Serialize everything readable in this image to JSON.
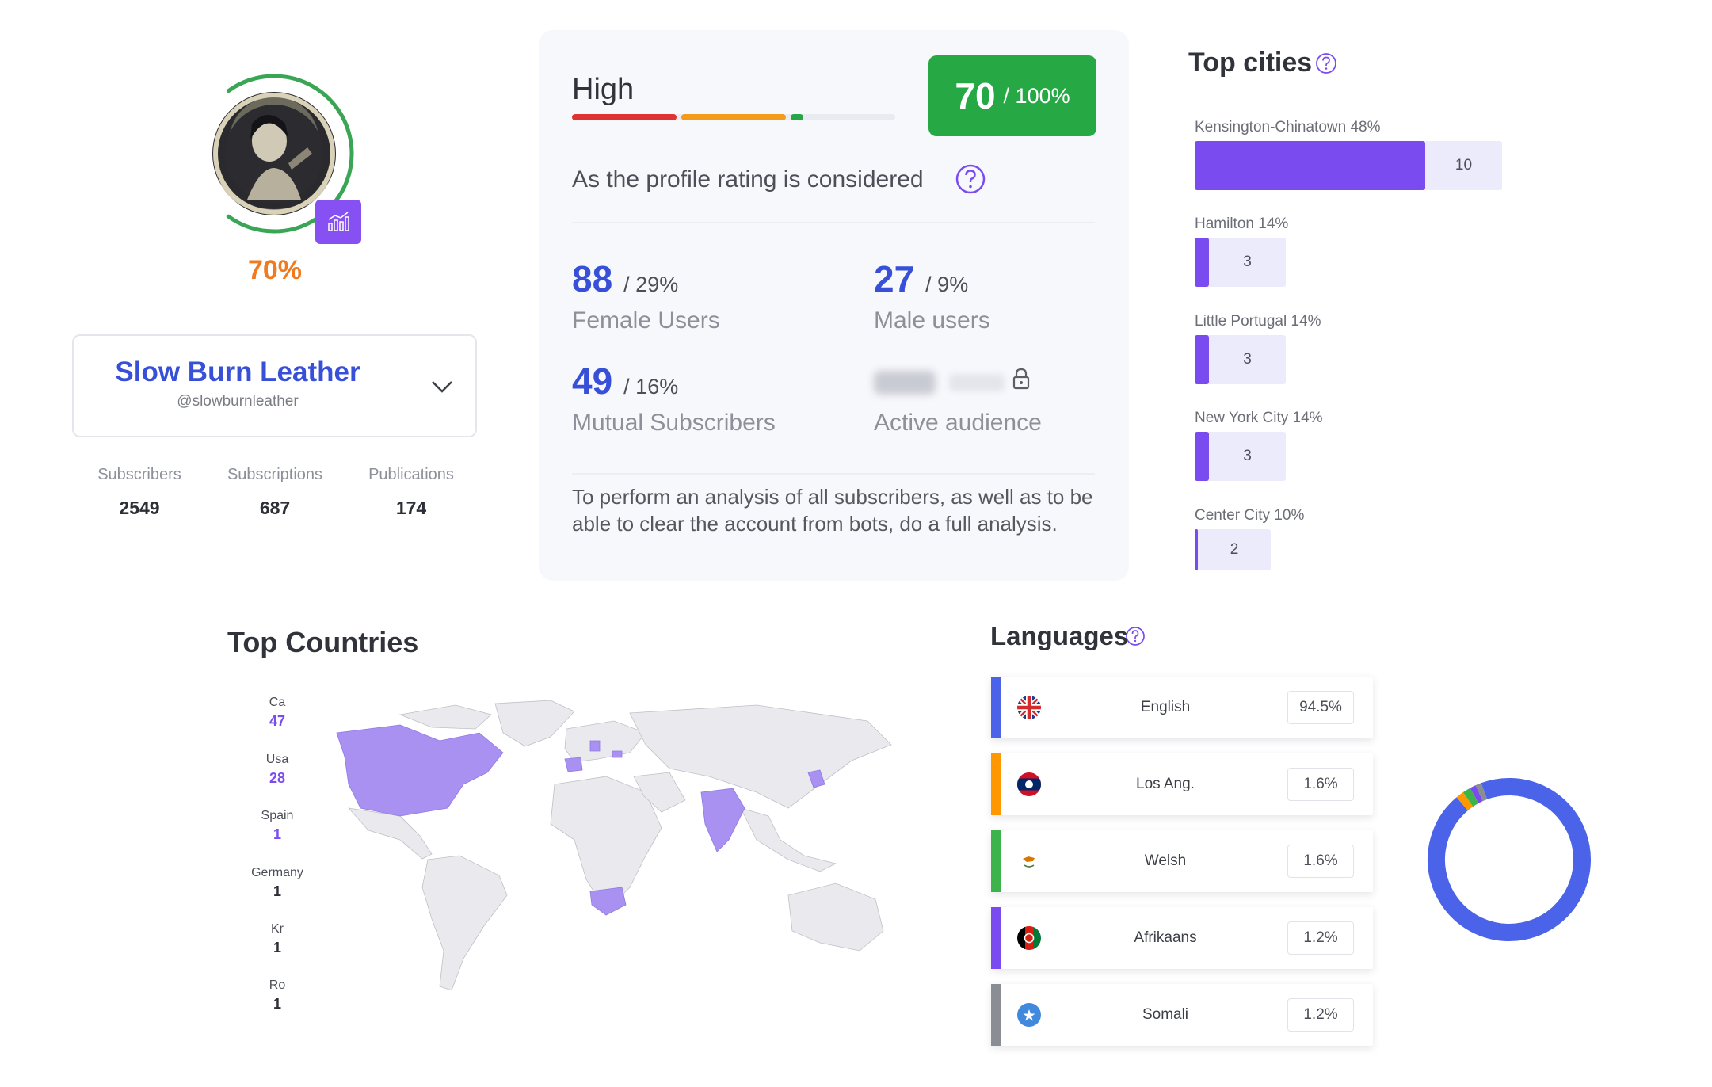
{
  "profile": {
    "rating_percent": "70%",
    "rating_value": 0.7,
    "name": "Slow Burn Leather",
    "handle": "@slowburnleather",
    "stats": [
      {
        "label": "Subscribers",
        "value": "2549"
      },
      {
        "label": "Subscriptions",
        "value": "687"
      },
      {
        "label": "Publications",
        "value": "174"
      }
    ]
  },
  "rating": {
    "level": "High",
    "score": "70",
    "score_total": "/ 100%",
    "score_value": 0.7,
    "description": "As the profile rating is considered",
    "metrics": [
      {
        "value": "88",
        "percent": "/ 29%",
        "label": "Female Users"
      },
      {
        "value": "27",
        "percent": "/ 9%",
        "label": "Male users"
      },
      {
        "value": "49",
        "percent": "/ 16%",
        "label": "Mutual Subscribers"
      },
      {
        "label": "Active audience",
        "locked": true
      }
    ],
    "note": "To perform an analysis of all subscribers, as well as to be able to clear the account from bots, do a full analysis."
  },
  "cities": {
    "title": "Top cities",
    "items": [
      {
        "label": "Kensington-Chinatown 48%",
        "count": "10",
        "share": 0.48
      },
      {
        "label": "Hamilton 14%",
        "count": "3",
        "share": 0.14
      },
      {
        "label": "Little Portugal 14%",
        "count": "3",
        "share": 0.14
      },
      {
        "label": "New York City 14%",
        "count": "3",
        "share": 0.14
      },
      {
        "label": "Center City 10%",
        "count": "2",
        "share": 0.1
      }
    ]
  },
  "countries": {
    "title": "Top Countries",
    "items": [
      {
        "name": "Ca",
        "value": "47",
        "color": "#7a4cf0"
      },
      {
        "name": "Usa",
        "value": "28",
        "color": "#7a4cf0"
      },
      {
        "name": "Spain",
        "value": "1",
        "color": "#7a4cf0"
      },
      {
        "name": "Germany",
        "value": "1",
        "color": "#2c2f36"
      },
      {
        "name": "Kr",
        "value": "1",
        "color": "#2c2f36"
      },
      {
        "name": "Ro",
        "value": "1",
        "color": "#2c2f36"
      }
    ]
  },
  "languages": {
    "title": "Languages",
    "items": [
      {
        "name": "English",
        "percent": "94.5%",
        "share": 0.945,
        "color": "#4a63e8",
        "flag": "uk-flag-icon"
      },
      {
        "name": "Los Ang.",
        "percent": "1.6%",
        "share": 0.016,
        "color": "#ff9800",
        "flag": "laos-flag-icon"
      },
      {
        "name": "Welsh",
        "percent": "1.6%",
        "share": 0.016,
        "color": "#3cb44b",
        "flag": "cyprus-flag-icon"
      },
      {
        "name": "Afrikaans",
        "percent": "1.2%",
        "share": 0.012,
        "color": "#7a4cf0",
        "flag": "afghanistan-flag-icon"
      },
      {
        "name": "Somali",
        "percent": "1.2%",
        "share": 0.012,
        "color": "#8a8d94",
        "flag": "somalia-flag-icon"
      }
    ]
  }
}
